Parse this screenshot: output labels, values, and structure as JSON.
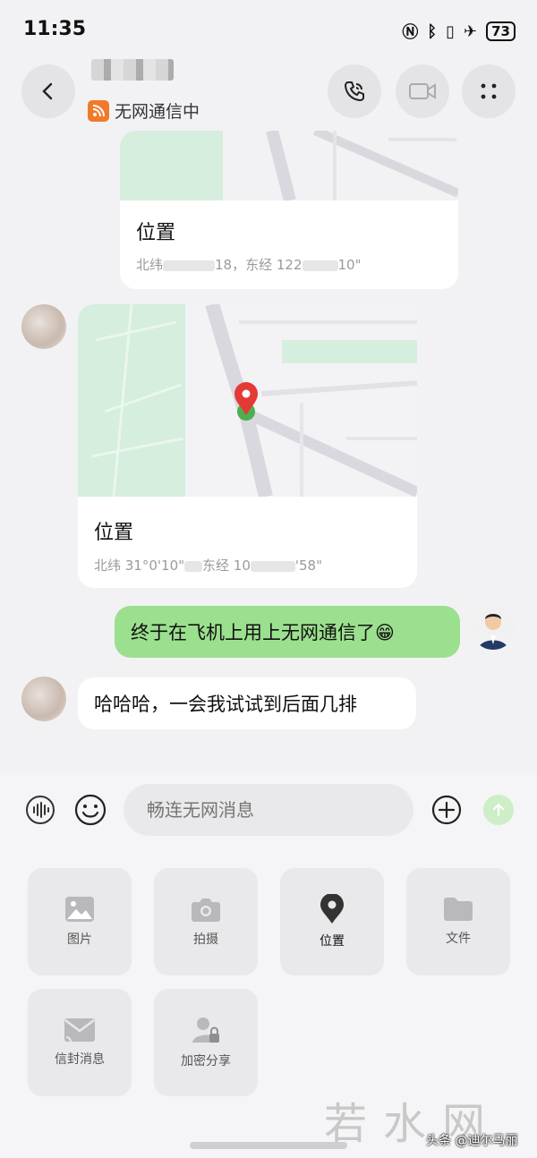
{
  "status_bar": {
    "time": "11:35",
    "battery": "73"
  },
  "header": {
    "status_text": "无网通信中"
  },
  "messages": [
    {
      "type": "location",
      "direction": "incoming",
      "title": "位置",
      "coords_prefix": "北纬",
      "coords_mid": "18，东经 122",
      "coords_end": "10\""
    },
    {
      "type": "location",
      "direction": "incoming",
      "title": "位置",
      "coords_prefix": "北纬 31°0'10\"",
      "coords_mid": "东经 10",
      "coords_end": "'58\""
    },
    {
      "type": "text",
      "direction": "outgoing",
      "text": "终于在飞机上用上无网通信了😁"
    },
    {
      "type": "text",
      "direction": "incoming",
      "text": "哈哈哈，一会我试试到后面几排"
    }
  ],
  "composer": {
    "placeholder": "畅连无网消息"
  },
  "panel": {
    "items": [
      {
        "label": "图片",
        "icon": "image-icon"
      },
      {
        "label": "拍摄",
        "icon": "camera-icon"
      },
      {
        "label": "位置",
        "icon": "location-pin-icon"
      },
      {
        "label": "文件",
        "icon": "folder-icon"
      },
      {
        "label": "信封消息",
        "icon": "envelope-icon"
      },
      {
        "label": "加密分享",
        "icon": "secure-share-icon"
      }
    ]
  },
  "watermark": "若水网",
  "credit": "头条 @迪尔马丽",
  "colors": {
    "outgoing_bubble": "#9be08e",
    "pin": "#e53935",
    "map_green": "#d6eedd",
    "accent_orange": "#f07a2a"
  }
}
